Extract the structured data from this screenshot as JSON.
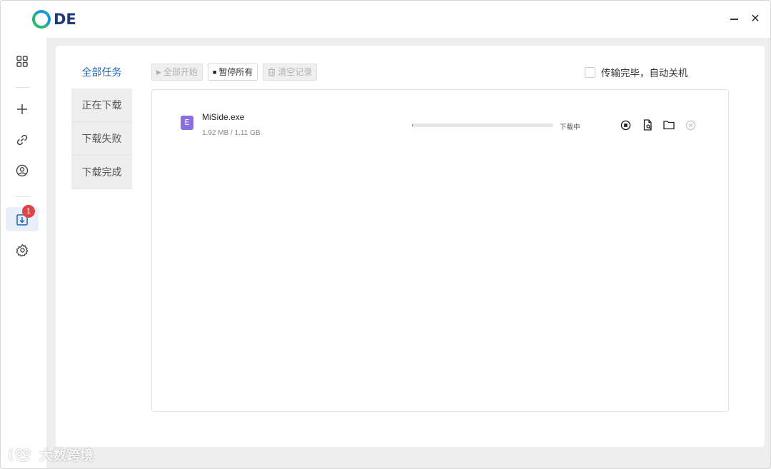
{
  "app": {
    "logo_text": "DE"
  },
  "window_controls": {
    "minimize": "minimize",
    "close": "close"
  },
  "sidebar": {
    "items": [
      {
        "name": "dashboard",
        "icon": "grid-icon"
      },
      {
        "name": "add",
        "icon": "plus-icon"
      },
      {
        "name": "link",
        "icon": "link-icon"
      },
      {
        "name": "account",
        "icon": "user-icon"
      },
      {
        "name": "downloads",
        "icon": "download-icon",
        "badge": "1",
        "active": true
      },
      {
        "name": "settings",
        "icon": "gear-icon"
      }
    ]
  },
  "tabs": [
    {
      "label": "全部任务",
      "active": true
    },
    {
      "label": "正在下载"
    },
    {
      "label": "下载失败"
    },
    {
      "label": "下载完成"
    }
  ],
  "toolbar": {
    "start_all": "全部开始",
    "pause_all": "暂停所有",
    "clear_records": "清空记录"
  },
  "auto_shutdown": {
    "label": "传输完毕，自动关机",
    "checked": false
  },
  "downloads": [
    {
      "file_badge": "E",
      "filename": "MiSide.exe",
      "size_text": "1.92 MB / 1.11 GB",
      "progress_percent": 0.17,
      "status": "下载中"
    }
  ],
  "watermark": {
    "text": "大数跨境"
  },
  "colors": {
    "accent": "#1565c0",
    "badge": "#e04343",
    "file_icon": "#8b6fe0"
  }
}
